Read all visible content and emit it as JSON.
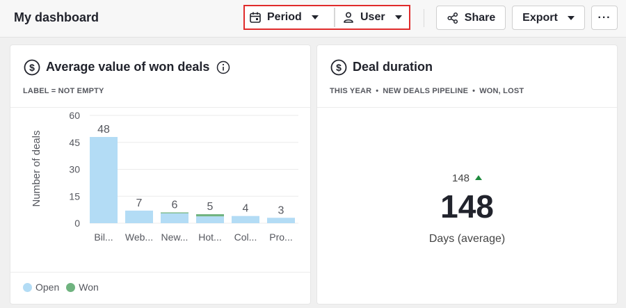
{
  "header": {
    "title": "My dashboard",
    "period_label": "Period",
    "user_label": "User",
    "share_label": "Share",
    "export_label": "Export",
    "more_label": "···"
  },
  "cards": [
    {
      "title": "Average value of won deals",
      "subtitle": "LABEL = NOT EMPTY",
      "legend": [
        {
          "label": "Open",
          "color": "#b3dcf5"
        },
        {
          "label": "Won",
          "color": "#6fb37f"
        }
      ]
    },
    {
      "title": "Deal duration",
      "subtitle_parts": [
        "THIS YEAR",
        "NEW DEALS PIPELINE",
        "WON, LOST"
      ],
      "kpi": {
        "previous": "148",
        "value": "148",
        "label": "Days (average)"
      }
    }
  ],
  "chart_data": {
    "type": "bar",
    "ylabel": "Number of deals",
    "ylim": [
      0,
      60
    ],
    "yticks": [
      0,
      15,
      30,
      45,
      60
    ],
    "categories": [
      "Bil...",
      "Web...",
      "New...",
      "Hot...",
      "Col...",
      "Pro..."
    ],
    "totals": [
      48,
      7,
      6,
      5,
      4,
      3
    ],
    "series": [
      {
        "name": "Open",
        "color": "#b3dcf5",
        "values": [
          48,
          7,
          5.5,
          3.8,
          4,
          3
        ]
      },
      {
        "name": "Won",
        "color": "#6fb37f",
        "values": [
          0,
          0,
          0.5,
          1.2,
          0,
          0
        ]
      }
    ],
    "grid": true
  }
}
